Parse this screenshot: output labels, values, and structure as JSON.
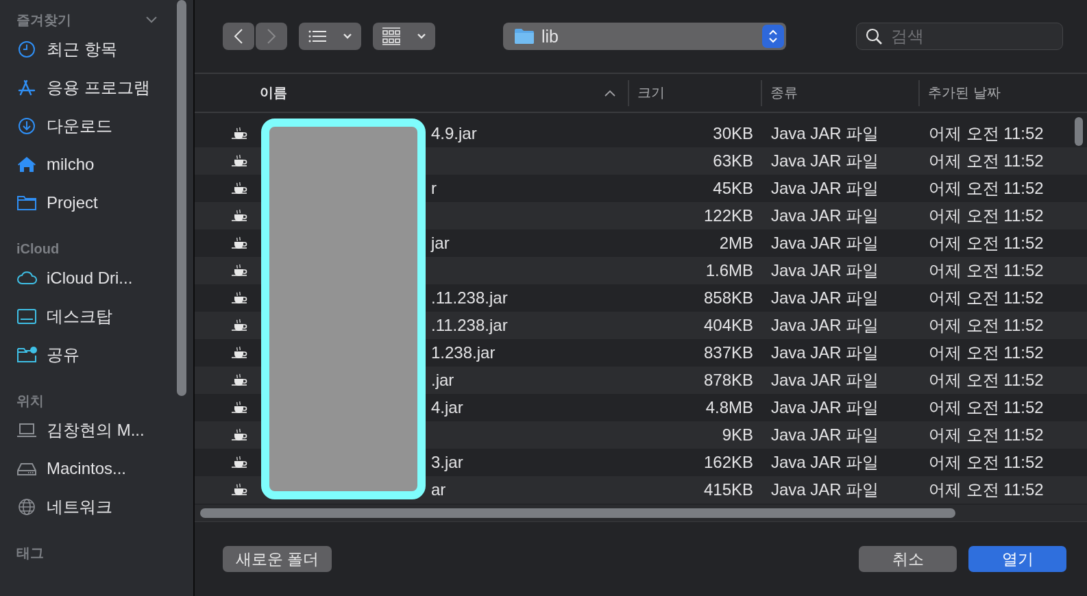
{
  "sidebar": {
    "sections": [
      {
        "heading": "즐겨찾기",
        "collapsible": true,
        "items": [
          {
            "label": "최근 항목"
          },
          {
            "label": "응용 프로그램"
          },
          {
            "label": "다운로드"
          },
          {
            "label": "milcho"
          },
          {
            "label": "Project"
          }
        ]
      },
      {
        "heading": "iCloud",
        "collapsible": false,
        "items": [
          {
            "label": "iCloud Dri..."
          },
          {
            "label": "데스크탑"
          },
          {
            "label": "공유"
          }
        ]
      },
      {
        "heading": "위치",
        "collapsible": false,
        "items": [
          {
            "label": "김창현의 M..."
          },
          {
            "label": "Macintos..."
          },
          {
            "label": "네트워크"
          }
        ]
      },
      {
        "heading": "태그",
        "collapsible": false
      }
    ]
  },
  "toolbar": {
    "location": "lib",
    "search": {
      "placeholder": "검색"
    }
  },
  "table": {
    "columns": [
      {
        "label": "이름",
        "sorted": true
      },
      {
        "label": "크기",
        "sorted": false
      },
      {
        "label": "종류",
        "sorted": false
      },
      {
        "label": "추가된 날짜",
        "sorted": false
      }
    ],
    "rows": [
      {
        "name": "4.9.jar",
        "size": "30KB",
        "kind": "Java JAR 파일",
        "date_added": "어제 오전 11:52"
      },
      {
        "size": "63KB",
        "kind": "Java JAR 파일",
        "date_added": "어제 오전 11:52"
      },
      {
        "name": "r",
        "size": "45KB",
        "kind": "Java JAR 파일",
        "date_added": "어제 오전 11:52"
      },
      {
        "size": "122KB",
        "kind": "Java JAR 파일",
        "date_added": "어제 오전 11:52"
      },
      {
        "name": "jar",
        "size": "2MB",
        "kind": "Java JAR 파일",
        "date_added": "어제 오전 11:52"
      },
      {
        "size": "1.6MB",
        "kind": "Java JAR 파일",
        "date_added": "어제 오전 11:52"
      },
      {
        "name": ".11.238.jar",
        "size": "858KB",
        "kind": "Java JAR 파일",
        "date_added": "어제 오전 11:52"
      },
      {
        "name": ".11.238.jar",
        "size": "404KB",
        "kind": "Java JAR 파일",
        "date_added": "어제 오전 11:52"
      },
      {
        "name": "1.238.jar",
        "size": "837KB",
        "kind": "Java JAR 파일",
        "date_added": "어제 오전 11:52"
      },
      {
        "name": ".jar",
        "size": "878KB",
        "kind": "Java JAR 파일",
        "date_added": "어제 오전 11:52"
      },
      {
        "name": "4.jar",
        "size": "4.8MB",
        "kind": "Java JAR 파일",
        "date_added": "어제 오전 11:52"
      },
      {
        "size": "9KB",
        "kind": "Java JAR 파일",
        "date_added": "어제 오전 11:52"
      },
      {
        "name": "3.jar",
        "size": "162KB",
        "kind": "Java JAR 파일",
        "date_added": "어제 오전 11:52"
      },
      {
        "name": "ar",
        "size": "415KB",
        "kind": "Java JAR 파일",
        "date_added": "어제 오전 11:52"
      }
    ]
  },
  "buttons": [
    {
      "label": "새로운 폴더",
      "kind": "secondary"
    },
    {
      "label": "취소",
      "kind": "secondary"
    },
    {
      "label": "열기",
      "kind": "primary"
    }
  ]
}
